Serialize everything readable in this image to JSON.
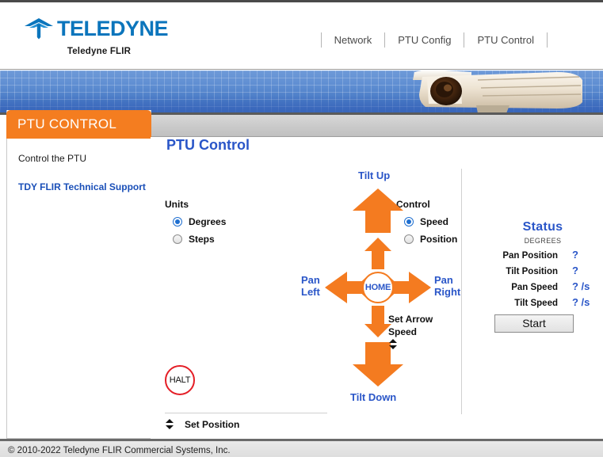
{
  "header": {
    "logo_word": "TELEDYNE",
    "logo_sub": "Teledyne FLIR",
    "logo_icon": "teledyne-chevron-logo",
    "nav": [
      {
        "label": "Network"
      },
      {
        "label": "PTU Config"
      },
      {
        "label": "PTU Control"
      }
    ]
  },
  "banner": {
    "camera_icon": "ptz-camera-photo"
  },
  "sidebar": {
    "title": "PTU CONTROL",
    "links": [
      {
        "label": "Control the PTU",
        "style": "plain"
      },
      {
        "label": "TDY FLIR Technical Support",
        "style": "link"
      }
    ]
  },
  "main": {
    "page_title": "PTU Control",
    "units": {
      "title": "Units",
      "options": [
        {
          "label": "Degrees",
          "selected": true
        },
        {
          "label": "Steps",
          "selected": false
        }
      ]
    },
    "control": {
      "title": "Control",
      "options": [
        {
          "label": "Speed",
          "selected": true
        },
        {
          "label": "Position",
          "selected": false
        }
      ]
    },
    "pad": {
      "tilt_up": "Tilt Up",
      "tilt_down": "Tilt Down",
      "pan_left_line1": "Pan",
      "pan_left_line2": "Left",
      "pan_right_line1": "Pan",
      "pan_right_line2": "Right",
      "home": "HOME",
      "halt": "HALT"
    },
    "arrow_speed": {
      "line1": "Set Arrow",
      "line2": "Speed",
      "spinner_icon": "up-down-spinner-icon"
    },
    "set_position": {
      "label": "Set Position",
      "spinner_icon": "up-down-spinner-icon"
    },
    "status": {
      "title": "Status",
      "units_label": "DEGREES",
      "rows": [
        {
          "name": "Pan Position",
          "value": "?"
        },
        {
          "name": "Tilt Position",
          "value": "?"
        },
        {
          "name": "Pan Speed",
          "value": "? /s"
        },
        {
          "name": "Tilt Speed",
          "value": "? /s"
        }
      ],
      "start_button": "Start"
    }
  },
  "footer": {
    "copyright": "© 2010-2022 Teledyne FLIR Commercial Systems, Inc."
  },
  "colors": {
    "brand_blue": "#0b75bc",
    "accent_orange": "#f47b20",
    "link_blue": "#2a56c8",
    "halt_red": "#e41e26"
  }
}
